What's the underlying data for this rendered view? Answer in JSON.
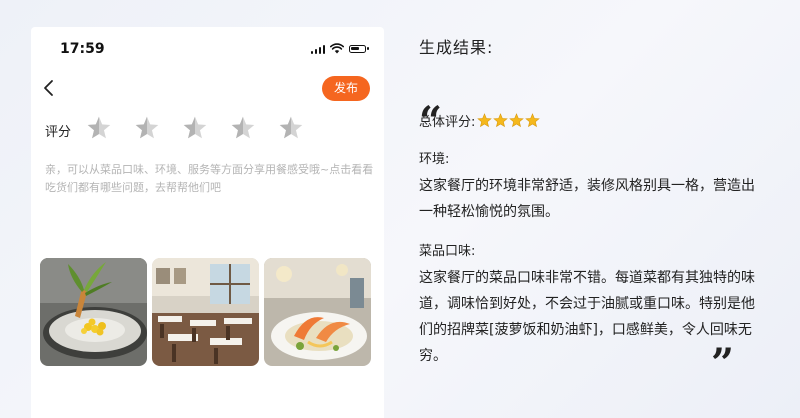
{
  "status_bar": {
    "time": "17:59"
  },
  "header": {
    "publish_label": "发布"
  },
  "rating": {
    "label": "评分",
    "stars_total": 5,
    "stars_selected": 0
  },
  "hint_text": "亲，可以从菜品口味、环境、服务等方面分享用餐感受哦~点击看看吃货们都有哪些问题，去帮帮他们吧",
  "photos": [
    "dish-photo",
    "restaurant-interior-photo",
    "shrimp-dish-photo"
  ],
  "result": {
    "title": "生成结果:",
    "overall_label": "总体评分:",
    "overall_stars": 4,
    "sections": [
      {
        "label": "环境:",
        "body": "这家餐厅的环境非常舒适，装修风格别具一格，营造出一种轻松愉悦的氛围。"
      },
      {
        "label": "菜品口味:",
        "body": "这家餐厅的菜品口味非常不错。每道菜都有其独特的味道，调味恰到好处，不会过于油腻或重口味。特别是他们的招牌菜[菠萝饭和奶油虾]，口感鲜美，令人回味无穷。"
      }
    ]
  },
  "colors": {
    "accent": "#f5661f",
    "star_empty": "#bdbdbd",
    "star_gold": "#f5b81c"
  }
}
